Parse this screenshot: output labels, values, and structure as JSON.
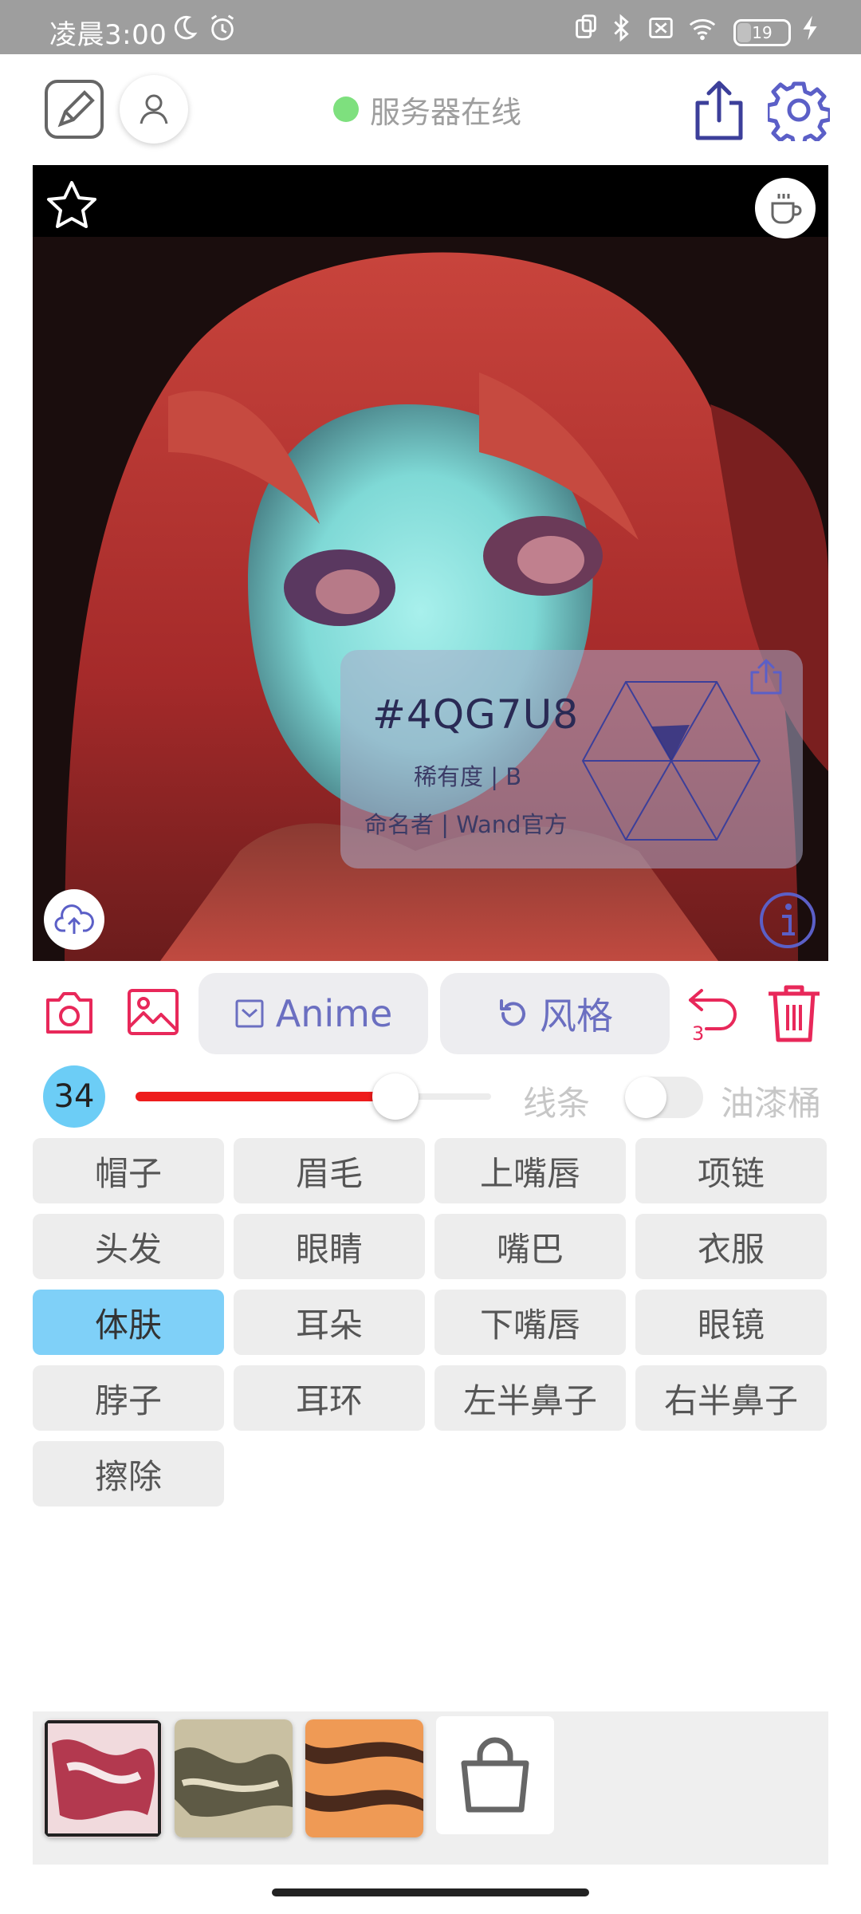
{
  "status_bar": {
    "time": "凌晨3:00",
    "battery": "19"
  },
  "top_bar": {
    "server_status": "服务器在线",
    "server_status_color": "#7ee07e",
    "icons": [
      "edit-icon",
      "user-icon",
      "share-icon",
      "settings-icon"
    ]
  },
  "card": {
    "code": "#4QG7U8",
    "rarity": "稀有度 | B",
    "namer": "命名者 | Wand官方"
  },
  "toolbar": {
    "anime_label": "Anime",
    "style_label": "风格",
    "undo_count": "3"
  },
  "brush": {
    "size": "34",
    "slider_fraction": 0.73,
    "line_label": "线条",
    "paint_bucket_label": "油漆桶",
    "paint_bucket_on": false
  },
  "parts": [
    {
      "label": "帽子",
      "active": false
    },
    {
      "label": "眉毛",
      "active": false
    },
    {
      "label": "上嘴唇",
      "active": false
    },
    {
      "label": "项链",
      "active": false
    },
    {
      "label": "头发",
      "active": false
    },
    {
      "label": "眼睛",
      "active": false
    },
    {
      "label": "嘴巴",
      "active": false
    },
    {
      "label": "衣服",
      "active": false
    },
    {
      "label": "体肤",
      "active": true
    },
    {
      "label": "耳朵",
      "active": false
    },
    {
      "label": "下嘴唇",
      "active": false
    },
    {
      "label": "眼镜",
      "active": false
    },
    {
      "label": "脖子",
      "active": false
    },
    {
      "label": "耳环",
      "active": false
    },
    {
      "label": "左半鼻子",
      "active": false
    },
    {
      "label": "右半鼻子",
      "active": false
    },
    {
      "label": "擦除",
      "active": false
    }
  ],
  "colors": {
    "accent_red": "#e8285a",
    "accent_purple": "#5b5fc7",
    "active_part": "#7fd0f8"
  }
}
